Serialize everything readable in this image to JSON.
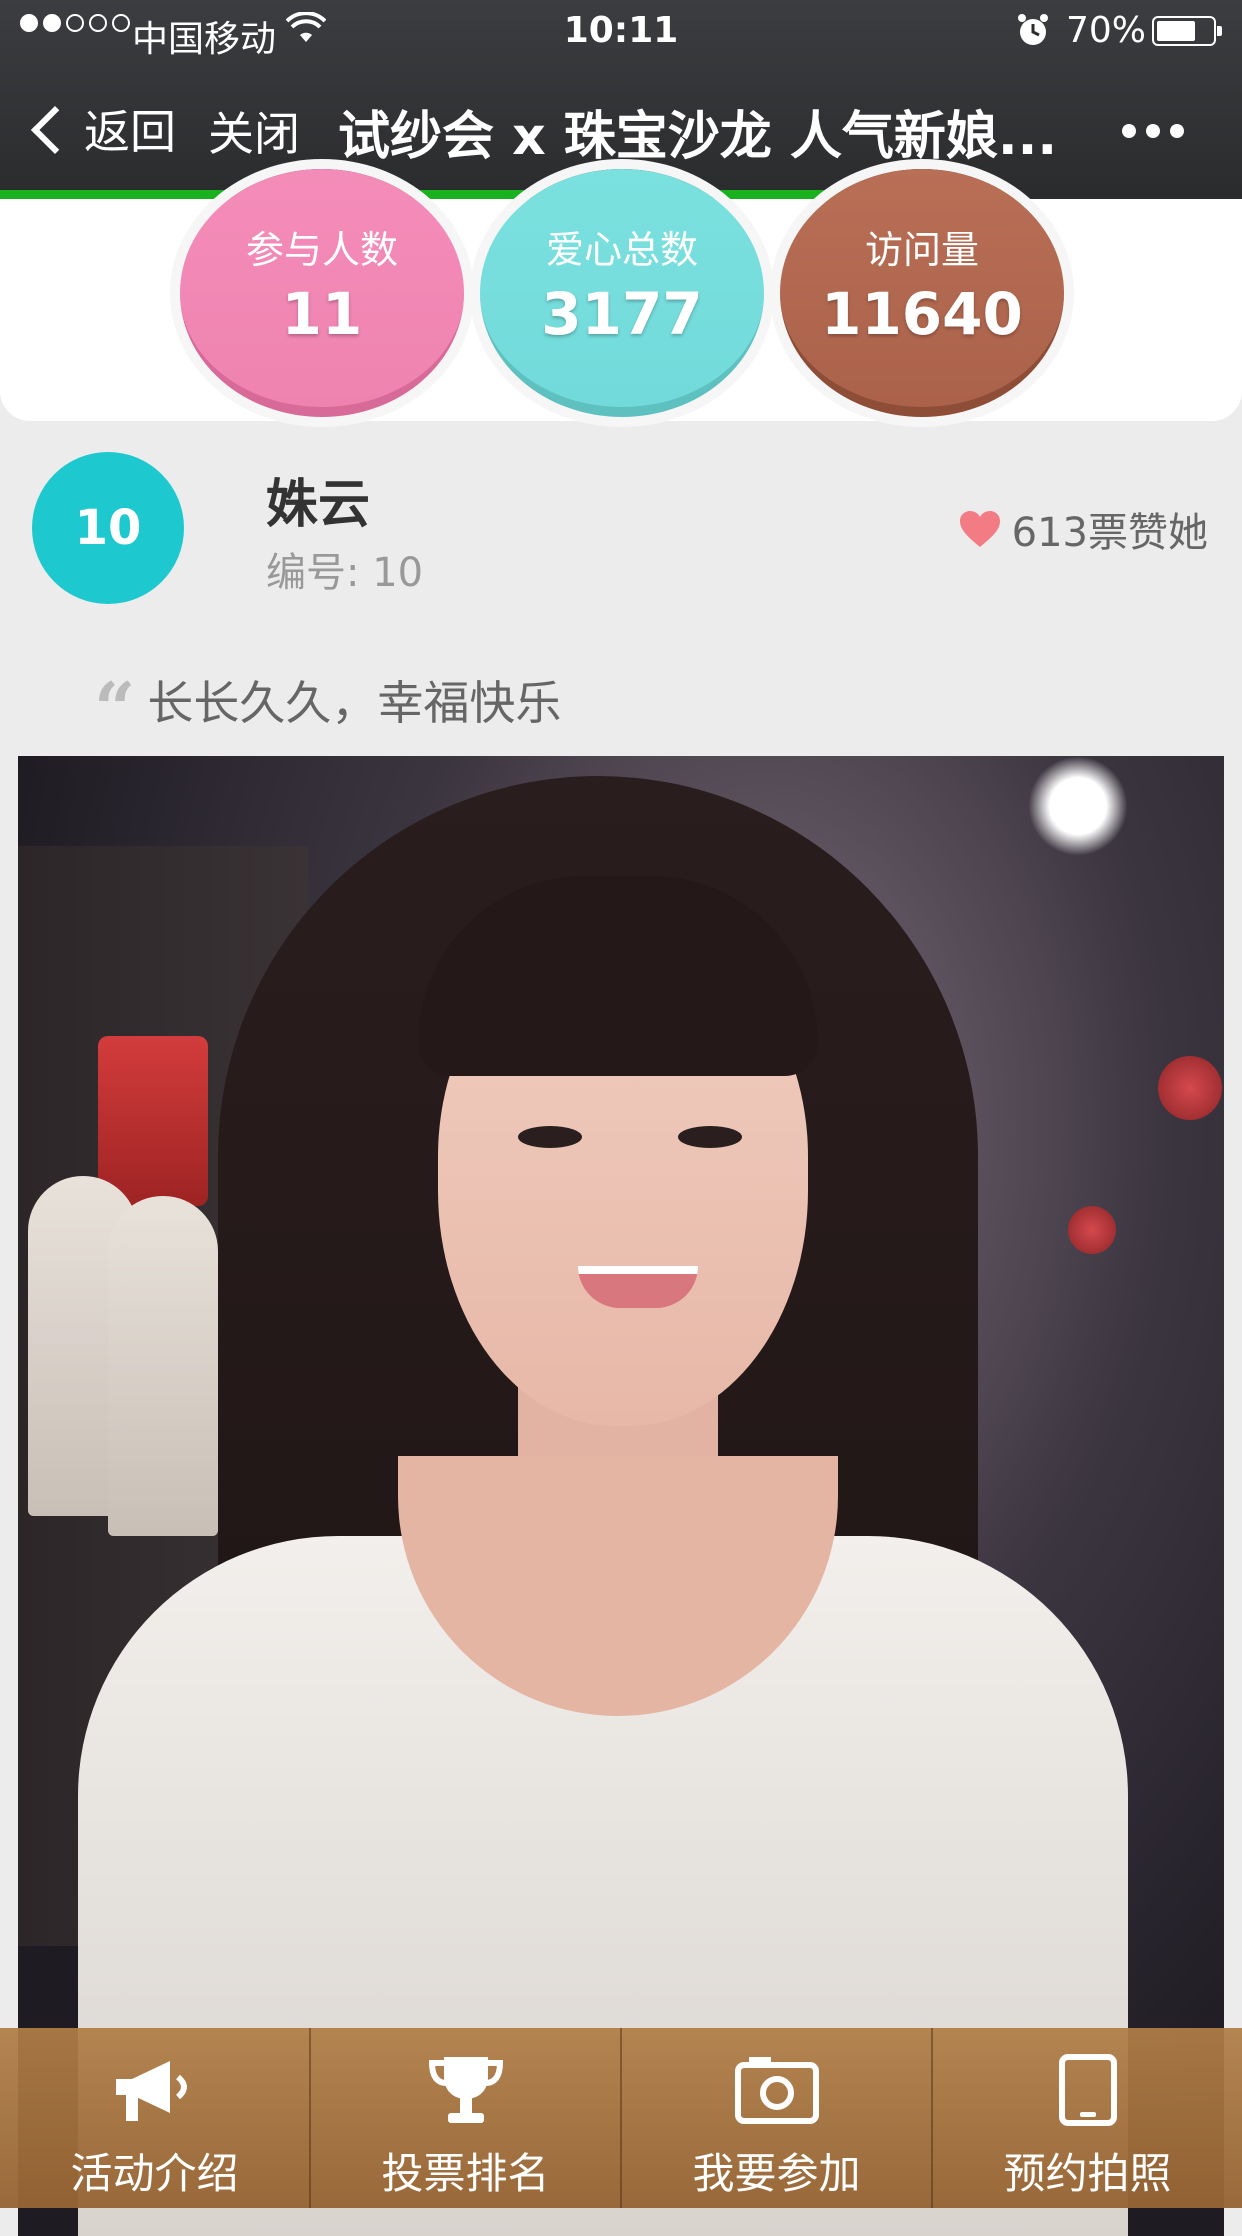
{
  "status_bar": {
    "carrier": "中国移动",
    "time": "10:11",
    "battery_pct": "70%",
    "battery_level": 0.7,
    "signal_bars_filled": 2,
    "signal_bars_total": 5
  },
  "nav": {
    "back_label": "返回",
    "close_label": "关闭",
    "title": "试纱会 x 珠宝沙龙 人气新娘...",
    "page_load_progress": 0.82
  },
  "stats": [
    {
      "label": "参与人数",
      "value": "11",
      "color": "#f48cb9"
    },
    {
      "label": "爱心总数",
      "value": "3177",
      "color": "#7be1df"
    },
    {
      "label": "访问量",
      "value": "11640",
      "color": "#b86f56"
    }
  ],
  "contestant": {
    "rank": "10",
    "name": "姝云",
    "number_label": "编号: 10",
    "votes_label": "613票赞她",
    "quote": "长长久久，幸福快乐"
  },
  "tabbar": {
    "items": [
      {
        "label": "活动介绍",
        "icon": "megaphone-icon"
      },
      {
        "label": "投票排名",
        "icon": "trophy-icon"
      },
      {
        "label": "我要参加",
        "icon": "camera-icon"
      },
      {
        "label": "预约拍照",
        "icon": "tablet-icon"
      }
    ]
  },
  "colors": {
    "accent_teal": "#1ec8cf",
    "heart": "#f37b84",
    "progress": "#19b21e",
    "tabbar": "#a8743d"
  }
}
